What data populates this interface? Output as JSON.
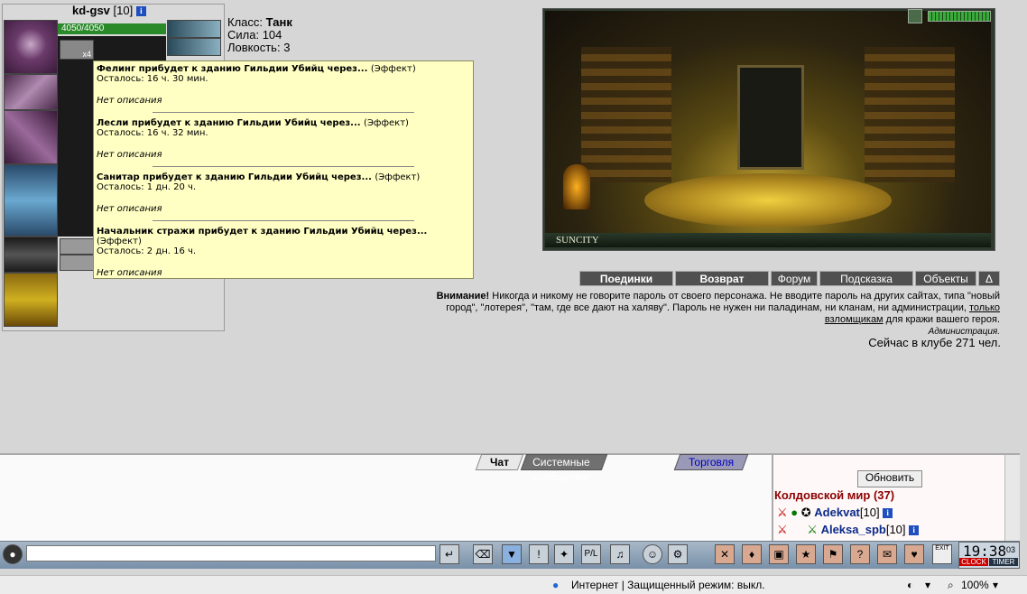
{
  "character": {
    "name": "kd-gsv",
    "level": "[10]",
    "hp": "4050/4050",
    "stack_count": "x4",
    "stats": [
      {
        "label": "Класс:",
        "value": "Танк"
      },
      {
        "label": "Сила:",
        "value": "104"
      },
      {
        "label": "Ловкость:",
        "value": "3"
      }
    ]
  },
  "tooltip": {
    "effects": [
      {
        "title": "Фелинг прибудет к зданию Гильдии Убийц через...",
        "type": "(Эффект)",
        "remaining": "Осталось: 16 ч. 30 мин.",
        "desc": "Нет описания"
      },
      {
        "title": "Лесли прибудет к зданию Гильдии Убийц через...",
        "type": "(Эффект)",
        "remaining": "Осталось: 16 ч. 32 мин.",
        "desc": "Нет описания"
      },
      {
        "title": "Санитар прибудет к зданию Гильдии Убийц через...",
        "type": "(Эффект)",
        "remaining": "Осталось: 1 дн. 20 ч.",
        "desc": "Нет описания"
      },
      {
        "title": "Начальник стражи прибудет к зданию Гильдии Убийц через...",
        "type": "(Эффект)",
        "remaining": "Осталось: 2 дн. 16 ч.",
        "desc": "Нет описания"
      }
    ]
  },
  "location": {
    "name": "SUNCITY"
  },
  "nav": {
    "duels": "Поединки",
    "return": "Возврат",
    "forum": "Форум",
    "hint": "Подсказка",
    "objects": "Объекты",
    "toggle": "Δ"
  },
  "warning": {
    "bold": "Внимание!",
    "text1": " Никогда и никому не говорите пароль от своего персонажа. Не вводите пароль на других сайтах, типа \"новый город\", \"лотерея\", \"там, где все дают на халяву\". Пароль не нужен ни паладинам, ни кланам, ни администрации, ",
    "link": "только взломщикам",
    "text2": " для кражи вашего героя.",
    "signature": "Администрация."
  },
  "online": "Сейчас в клубе 271 чел.",
  "chat": {
    "tabs": [
      "Чат",
      "Системные сообщения",
      "Торговля"
    ]
  },
  "users": {
    "refresh": "Обновить",
    "room": "Колдовской мир (37)",
    "list": [
      {
        "name": "Adekvat",
        "level": "[10]"
      },
      {
        "name": "Aleksa_spb",
        "level": "[10]"
      }
    ]
  },
  "clock": {
    "time": "19:38",
    "sec": "03",
    "clock_label": "CLOCK",
    "timer_label": "TIMER",
    "exit_label": "EXIT"
  },
  "status": {
    "zone": "Интернет | Защищенный режим: выкл.",
    "zoom": "100%"
  },
  "colors": {
    "tooltip_bg": "#ffffc4",
    "nav_btn": "#505050",
    "room_title": "#8b0000",
    "user_link": "#0a2a8a"
  }
}
